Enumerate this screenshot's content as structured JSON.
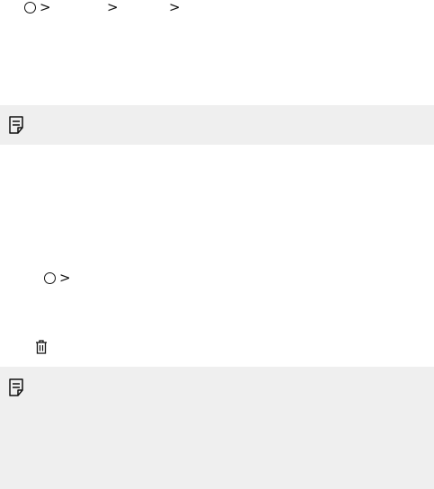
{
  "breadcrumb_top": {
    "icon": "home-circle-icon",
    "separators": [
      ">",
      ">",
      ">"
    ]
  },
  "note_box_1": {
    "icon": "note-icon"
  },
  "breadcrumb_mid": {
    "icon": "home-circle-icon",
    "separator": ">"
  },
  "delete_row": {
    "icon": "trash-icon"
  },
  "note_box_2": {
    "icon": "note-icon"
  },
  "colors": {
    "note_background": "#efefef",
    "icon_stroke": "#111111"
  }
}
